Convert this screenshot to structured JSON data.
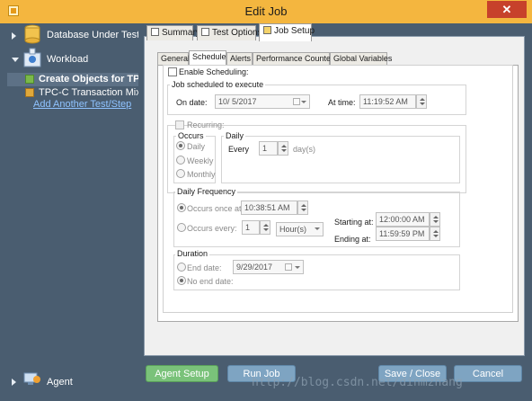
{
  "window": {
    "title": "Edit Job",
    "close_label": "✕"
  },
  "sidebar": {
    "database": "Database Under Test",
    "workload": "Workload",
    "items": [
      "Create Objects for TPC-C",
      "TPC-C Transaction Mix"
    ],
    "add_link": "Add Another Test/Step",
    "agent": "Agent"
  },
  "tabs": [
    "Summary",
    "Test Options",
    "Job Setup"
  ],
  "active_tab": "Job Setup",
  "subtabs": [
    "General",
    "Schedule",
    "Alerts",
    "Performance Counters",
    "Global Variables"
  ],
  "active_subtab": "Schedule",
  "schedule": {
    "enable_label": "Enable Scheduling:",
    "job_group": "Job scheduled to execute",
    "on_date_label": "On date:",
    "on_date_value": "10/  5/2017",
    "at_time_label": "At time:",
    "at_time_value": "11:19:52 AM",
    "recurring_label": "Recurring:",
    "occurs_group": "Occurs",
    "daily_group": "Daily",
    "occurs_options": [
      "Daily",
      "Weekly",
      "Monthly"
    ],
    "every_label": "Every",
    "every_value": "1",
    "days_label": "day(s)",
    "freq_group": "Daily Frequency",
    "occurs_once_label": "Occurs once at:",
    "occurs_once_value": "10:38:51 AM",
    "occurs_every_label": "Occurs every:",
    "occurs_every_value": "1",
    "unit_value": "Hour(s)",
    "starting_label": "Starting at:",
    "starting_value": "12:00:00 AM",
    "ending_label": "Ending at:",
    "ending_value": "11:59:59 PM",
    "duration_group": "Duration",
    "end_date_label": "End date:",
    "end_date_value": "9/29/2017",
    "no_end_label": "No end date:"
  },
  "buttons": {
    "agent_setup": "Agent Setup",
    "run_job": "Run Job",
    "save_close": "Save / Close",
    "cancel": "Cancel"
  },
  "watermark": "http://blog.csdn.net/dinmzhang",
  "colors": {
    "titlebar": "#f4b63f",
    "sidebar": "#4a5d70",
    "green_button": "#7ac27a",
    "blue_button": "#7ea4c2",
    "close": "#c7412b"
  }
}
